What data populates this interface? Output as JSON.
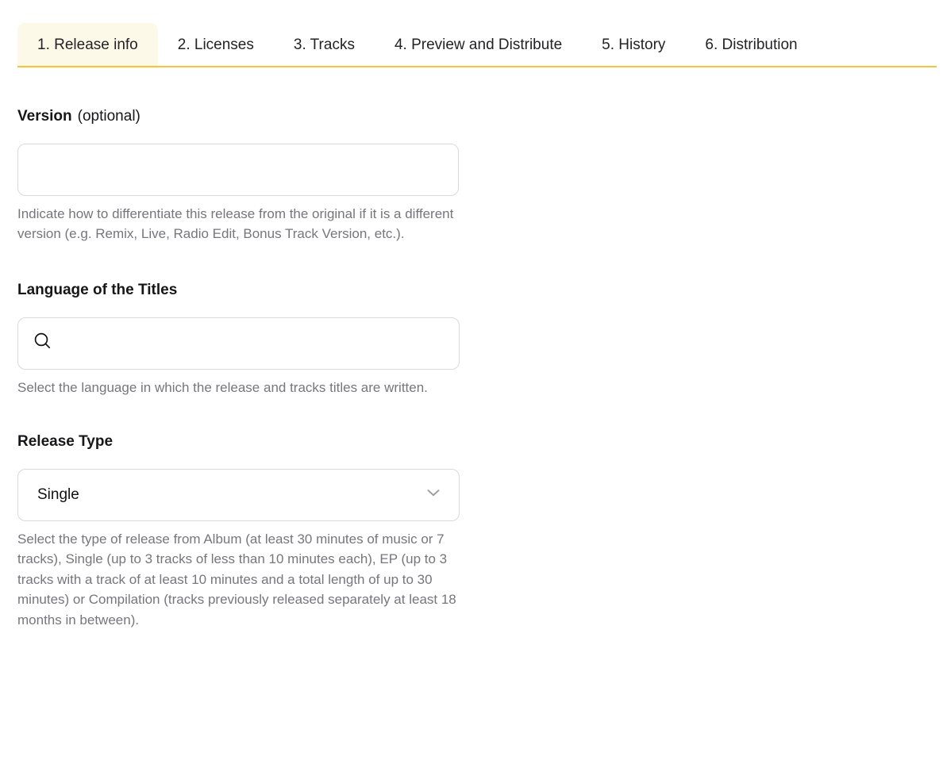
{
  "tabs": [
    {
      "label": "1. Release info",
      "active": true
    },
    {
      "label": "2. Licenses",
      "active": false
    },
    {
      "label": "3. Tracks",
      "active": false
    },
    {
      "label": "4. Preview and Distribute",
      "active": false
    },
    {
      "label": "5. History",
      "active": false
    },
    {
      "label": "6. Distribution",
      "active": false
    }
  ],
  "colors": {
    "accent": "#f5c43c",
    "active_tab_bg": "#fdf9e9",
    "border": "#d9d9de",
    "help_text": "#76767c",
    "text": "#1d1d1f"
  },
  "form": {
    "version": {
      "label": "Version",
      "optional_note": "(optional)",
      "value": "",
      "placeholder": "",
      "help": "Indicate how to differentiate this release from the original if it is a different version (e.g. Remix, Live, Radio Edit, Bonus Track Version, etc.)."
    },
    "language": {
      "label": "Language of the Titles",
      "icon": "search-icon",
      "value": "",
      "placeholder": "",
      "help": "Select the language in which the release and tracks titles are written."
    },
    "release_type": {
      "label": "Release Type",
      "value": "Single",
      "icon": "chevron-down-icon",
      "help": "Select the type of release from Album (at least 30 minutes of music or 7 tracks), Single (up to 3 tracks of less than 10 minutes each), EP (up to 3 tracks with a track of at least 10 minutes and a total length of up to 30 minutes) or Compilation (tracks previously released separately at least 18 months in between)."
    }
  }
}
